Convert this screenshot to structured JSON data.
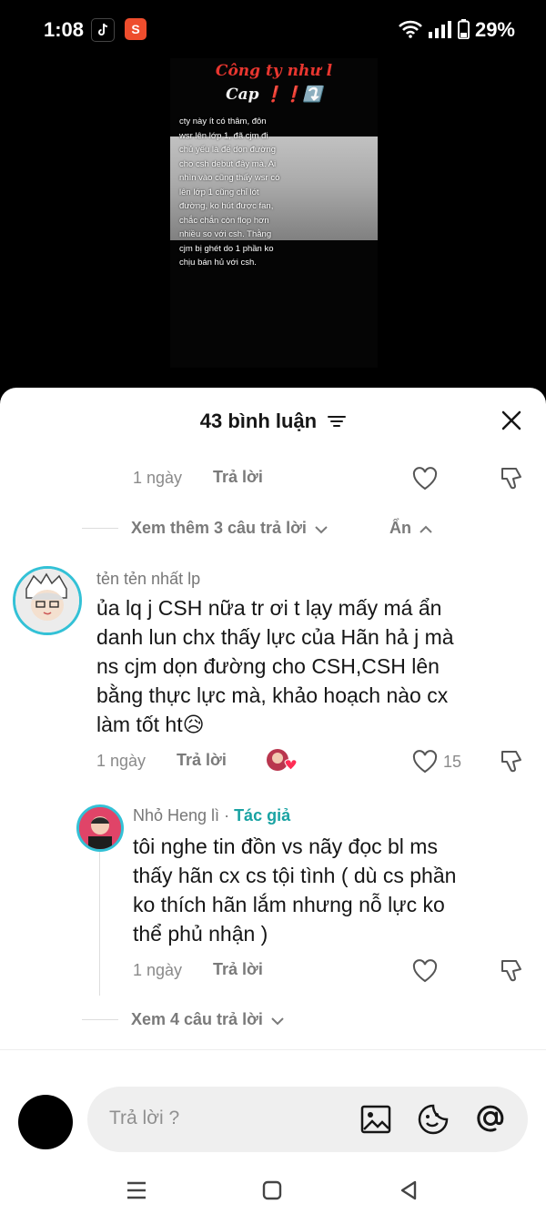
{
  "status_bar": {
    "time": "1:08",
    "battery": "29%"
  },
  "video": {
    "title_line1": "Công ty như l",
    "title_line2": "Cap ❗❗⤵️",
    "body_text": "cty này ít có thâm, đôn wsr lên lớp 1, đã cjm đi chủ yếu là để dọn đường cho csh debut đây mà. Ai nhìn vào cũng thấy wsr có lên lớp 1 cũng chỉ lót đường, ko hút được fan, chắc chắn còn flop hơn nhiều so với csh. Thằng cjm bị ghét do 1 phần ko chịu bán hủ với csh."
  },
  "sheet": {
    "title": "43 bình luận",
    "prev_reply": {
      "time": "1 ngày",
      "reply_label": "Trả lời"
    },
    "thread_controls": {
      "see_more": "Xem thêm 3 câu trả lời",
      "hide": "Ẩn"
    },
    "comment": {
      "username": "tẻn tẻn nhất lp",
      "lines": [
        "ủa lq j CSH nữa tr ơi t lạy mấy má ẩn",
        "danh lun chx thấy lực của Hãn hả j mà",
        "ns cjm dọn đường cho CSH,CSH lên",
        "bằng thực lực mà, khảo hoạch nào cx",
        "làm tốt ht😥"
      ],
      "time": "1 ngày",
      "reply_label": "Trả lời",
      "like_count": "15"
    },
    "reply": {
      "username": "Nhỏ Heng lì",
      "separator": " · ",
      "author_badge": "Tác giả",
      "lines": [
        "tôi nghe tin đồn vs nãy đọc bl ms",
        "thấy hãn cx cs tội tình ( dù cs phần",
        "ko thích hãn lắm nhưng nỗ lực ko",
        "thể phủ nhận )"
      ],
      "time": "1 ngày",
      "reply_label": "Trả lời"
    },
    "see_replies": "Xem 4 câu trả lời"
  },
  "composer": {
    "placeholder": "Trả lời ?"
  },
  "colors": {
    "author": "#1aa3a3",
    "sheet_bg": "#ffffff",
    "muted": "#8a8a8a"
  },
  "icons": [
    "tiktok-icon",
    "shopee-icon",
    "wifi-icon",
    "signal-icon",
    "battery-icon",
    "filter-icon",
    "close-icon",
    "heart-icon",
    "dislike-icon",
    "image-icon",
    "emoji-icon",
    "mention-icon",
    "menu-icon",
    "home-icon",
    "back-icon"
  ]
}
